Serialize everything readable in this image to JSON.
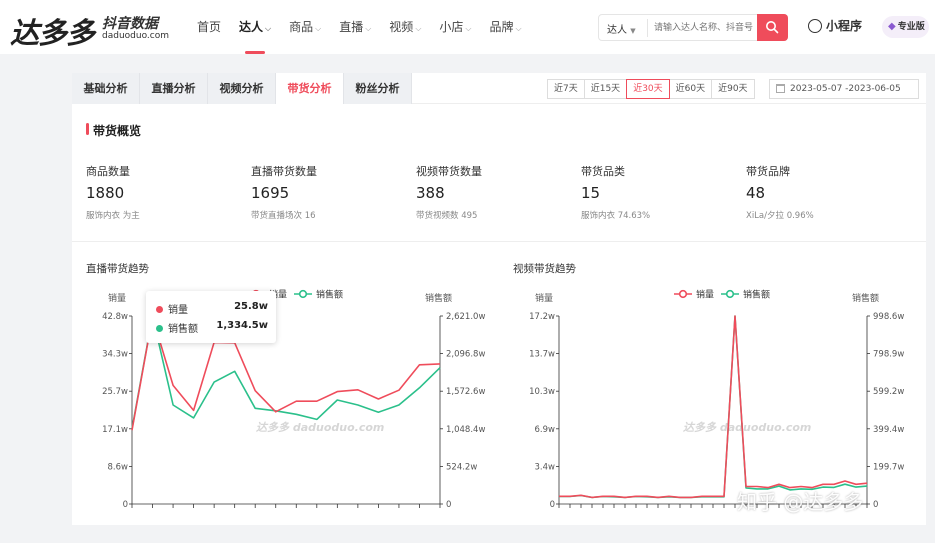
{
  "brand": {
    "logo": "达多多",
    "subtitle": "抖音数据",
    "domain": "daduoduo.com"
  },
  "nav": [
    {
      "label": "首页",
      "dropdown": false
    },
    {
      "label": "达人",
      "dropdown": true,
      "active": true
    },
    {
      "label": "商品",
      "dropdown": true
    },
    {
      "label": "直播",
      "dropdown": true
    },
    {
      "label": "视频",
      "dropdown": true
    },
    {
      "label": "小店",
      "dropdown": true
    },
    {
      "label": "品牌",
      "dropdown": true
    }
  ],
  "search": {
    "type": "达人",
    "placeholder": "请输入达人名称、抖音号"
  },
  "mini_program": "小程序",
  "pro": "专业版",
  "tabs": [
    "基础分析",
    "直播分析",
    "视频分析",
    "带货分析",
    "粉丝分析"
  ],
  "active_tab": "带货分析",
  "ranges": [
    "近7天",
    "近15天",
    "近30天",
    "近60天",
    "近90天"
  ],
  "active_range": "近30天",
  "date_range": "2023-05-07  -2023-06-05",
  "section_title": "带货概览",
  "stats": [
    {
      "label": "商品数量",
      "value": "1880",
      "sub": "服饰内衣 为主"
    },
    {
      "label": "直播带货数量",
      "value": "1695",
      "sub": "带货直播场次 16"
    },
    {
      "label": "视频带货数量",
      "value": "388",
      "sub": "带货视频数 495"
    },
    {
      "label": "带货品类",
      "value": "15",
      "sub": "服饰内衣 74.63%"
    },
    {
      "label": "带货品牌",
      "value": "48",
      "sub": "XiLa/夕拉 0.96%"
    }
  ],
  "colors": {
    "sales_volume": "#ef4c5b",
    "sales_amount": "#2bc08b",
    "accent": "#ef4c5b"
  },
  "tooltip": {
    "rows": [
      {
        "label": "销量",
        "value": "25.8w"
      },
      {
        "label": "销售额",
        "value": "1,334.5w"
      }
    ]
  },
  "watermark": "知乎 @达多多",
  "chart_watermark": "达多多 daduoduo.com",
  "chart_data": [
    {
      "type": "line",
      "title": "直播带货趋势",
      "legend": [
        "销量",
        "销售额"
      ],
      "left_axis_label": "销量",
      "right_axis_label": "销售额",
      "left_ticks": [
        "0",
        "8.6w",
        "17.1w",
        "25.7w",
        "34.3w",
        "42.8w"
      ],
      "right_ticks": [
        "0",
        "524.2w",
        "1,048.4w",
        "1,572.6w",
        "2,096.8w",
        "2,621.0w"
      ],
      "left_ylim": [
        0,
        42.8
      ],
      "right_ylim": [
        0,
        2621.0
      ],
      "n_points": 16,
      "series": [
        {
          "name": "销量",
          "axis": "left",
          "values": [
            16.8,
            42.6,
            27.0,
            21.3,
            36.8,
            36.7,
            25.8,
            21.0,
            23.4,
            23.4,
            25.6,
            26.0,
            23.9,
            25.9,
            31.7,
            31.9
          ]
        },
        {
          "name": "销售额",
          "axis": "right",
          "values": [
            1048,
            2621,
            1380,
            1200,
            1700,
            1850,
            1334.5,
            1300,
            1250,
            1180,
            1450,
            1380,
            1280,
            1380,
            1620,
            1900
          ]
        }
      ]
    },
    {
      "type": "line",
      "title": "视频带货趋势",
      "legend": [
        "销量",
        "销售额"
      ],
      "left_axis_label": "销量",
      "right_axis_label": "销售额",
      "left_ticks": [
        "0",
        "3.4w",
        "6.9w",
        "10.3w",
        "13.7w",
        "17.2w"
      ],
      "right_ticks": [
        "0",
        "199.7w",
        "399.4w",
        "599.2w",
        "798.9w",
        "998.6w"
      ],
      "left_ylim": [
        0,
        17.2
      ],
      "right_ylim": [
        0,
        998.6
      ],
      "n_points": 29,
      "series": [
        {
          "name": "销量",
          "axis": "left",
          "values": [
            0.7,
            0.7,
            0.8,
            0.6,
            0.7,
            0.7,
            0.6,
            0.7,
            0.7,
            0.6,
            0.7,
            0.6,
            0.6,
            0.7,
            0.7,
            0.7,
            17.2,
            1.6,
            1.6,
            1.5,
            1.8,
            1.5,
            1.6,
            1.5,
            1.8,
            1.8,
            2.1,
            1.8,
            1.9
          ]
        },
        {
          "name": "销售额",
          "axis": "right",
          "values": [
            40,
            40,
            45,
            35,
            40,
            38,
            35,
            40,
            38,
            35,
            38,
            35,
            35,
            38,
            38,
            38,
            998.6,
            85,
            80,
            80,
            95,
            75,
            80,
            78,
            90,
            88,
            105,
            90,
            95
          ]
        }
      ]
    }
  ]
}
